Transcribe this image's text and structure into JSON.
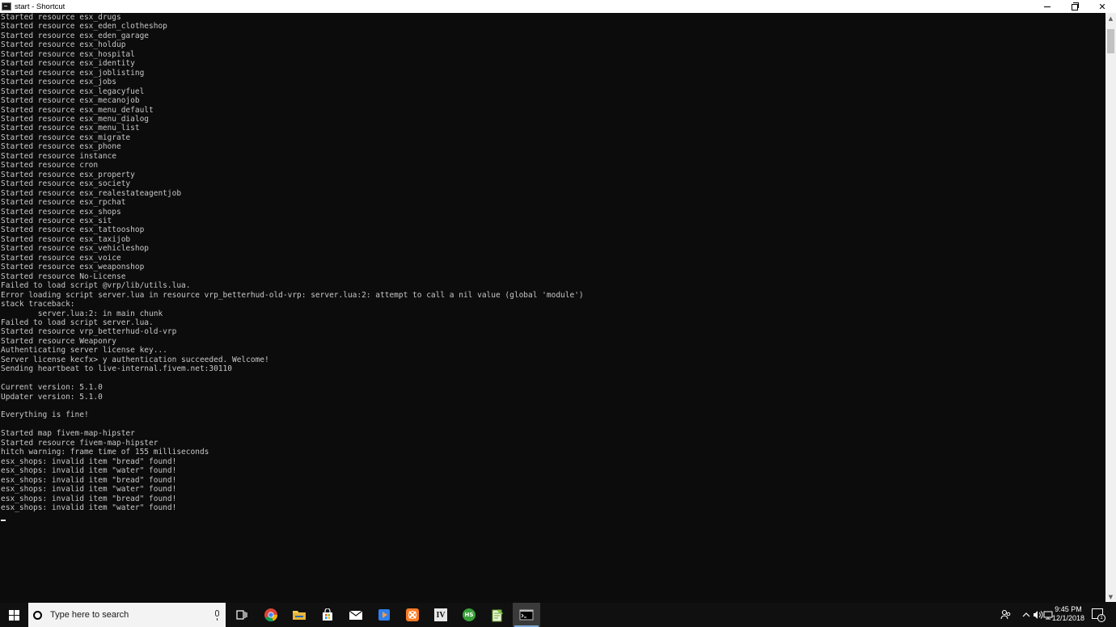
{
  "window": {
    "title": "start - Shortcut",
    "icon": "console-icon"
  },
  "console": {
    "lines": [
      "Started resource esx_drugs",
      "Started resource esx_eden_clotheshop",
      "Started resource esx_eden_garage",
      "Started resource esx_holdup",
      "Started resource esx_hospital",
      "Started resource esx_identity",
      "Started resource esx_joblisting",
      "Started resource esx_jobs",
      "Started resource esx_legacyfuel",
      "Started resource esx_mecanojob",
      "Started resource esx_menu_default",
      "Started resource esx_menu_dialog",
      "Started resource esx_menu_list",
      "Started resource esx_migrate",
      "Started resource esx_phone",
      "Started resource instance",
      "Started resource cron",
      "Started resource esx_property",
      "Started resource esx_society",
      "Started resource esx_realestateagentjob",
      "Started resource esx_rpchat",
      "Started resource esx_shops",
      "Started resource esx_sit",
      "Started resource esx_tattooshop",
      "Started resource esx_taxijob",
      "Started resource esx_vehicleshop",
      "Started resource esx_voice",
      "Started resource esx_weaponshop",
      "Started resource No-License",
      "Failed to load script @vrp/lib/utils.lua.",
      "Error loading script server.lua in resource vrp_betterhud-old-vrp: server.lua:2: attempt to call a nil value (global 'module')",
      "stack traceback:",
      "        server.lua:2: in main chunk",
      "Failed to load script server.lua.",
      "Started resource vrp_betterhud-old-vrp",
      "Started resource Weaponry",
      "Authenticating server license key...",
      "Server license kecfx> y authentication succeeded. Welcome!",
      "Sending heartbeat to live-internal.fivem.net:30110",
      "",
      "Current version: 5.1.0",
      "Updater version: 5.1.0",
      "",
      "Everything is fine!",
      "",
      "Started map fivem-map-hipster",
      "Started resource fivem-map-hipster",
      "hitch warning: frame time of 155 milliseconds",
      "esx_shops: invalid item \"bread\" found!",
      "esx_shops: invalid item \"water\" found!",
      "esx_shops: invalid item \"bread\" found!",
      "esx_shops: invalid item \"water\" found!",
      "esx_shops: invalid item \"bread\" found!",
      "esx_shops: invalid item \"water\" found!"
    ]
  },
  "taskbar": {
    "search_placeholder": "Type here to search",
    "apps": [
      {
        "name": "chrome",
        "icon": "chrome-icon"
      },
      {
        "name": "file-explorer",
        "icon": "folder-icon"
      },
      {
        "name": "store",
        "icon": "store-icon"
      },
      {
        "name": "mail",
        "icon": "mail-icon"
      },
      {
        "name": "media-player",
        "icon": "play-icon"
      },
      {
        "name": "xampp",
        "icon": "xampp-icon"
      },
      {
        "name": "openiv",
        "icon": "openiv-icon"
      },
      {
        "name": "heidisql",
        "icon": "heidisql-icon",
        "label": "HS"
      },
      {
        "name": "notepad-plus-plus",
        "icon": "notepad-icon"
      },
      {
        "name": "command-prompt",
        "icon": "console-icon",
        "active": true
      }
    ],
    "clock_time": "9:45 PM",
    "clock_date": "12/1/2018",
    "notification_count": "1",
    "colors": {
      "accent": "#7aa7d6",
      "console_bg": "#0c0c0c",
      "console_text": "#c8c8c8"
    }
  }
}
